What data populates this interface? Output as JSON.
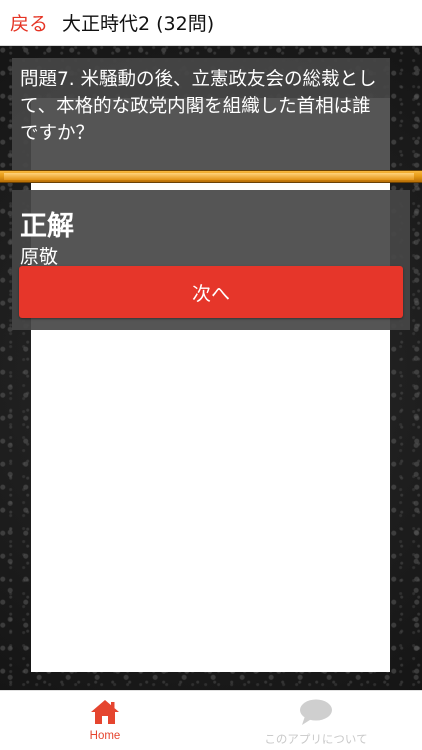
{
  "header": {
    "back_label": "戻る",
    "title": "大正時代2 (32問)"
  },
  "quiz": {
    "question": "問題7. 米騒動の後、立憲政友会の総裁として、本格的な政党内閣を組織した首相は誰ですか？",
    "progress_fraction": 0.99,
    "answer_heading": "正解",
    "answer": "原敬",
    "next_label": "次へ"
  },
  "tabs": [
    {
      "label": "Home",
      "icon": "home-icon",
      "active": true
    },
    {
      "label": "このアプリについて",
      "icon": "chat-bubble-icon",
      "active": false
    }
  ],
  "colors": {
    "accent": "#e53424",
    "progress": "#e79b17",
    "panel": "#464646"
  }
}
